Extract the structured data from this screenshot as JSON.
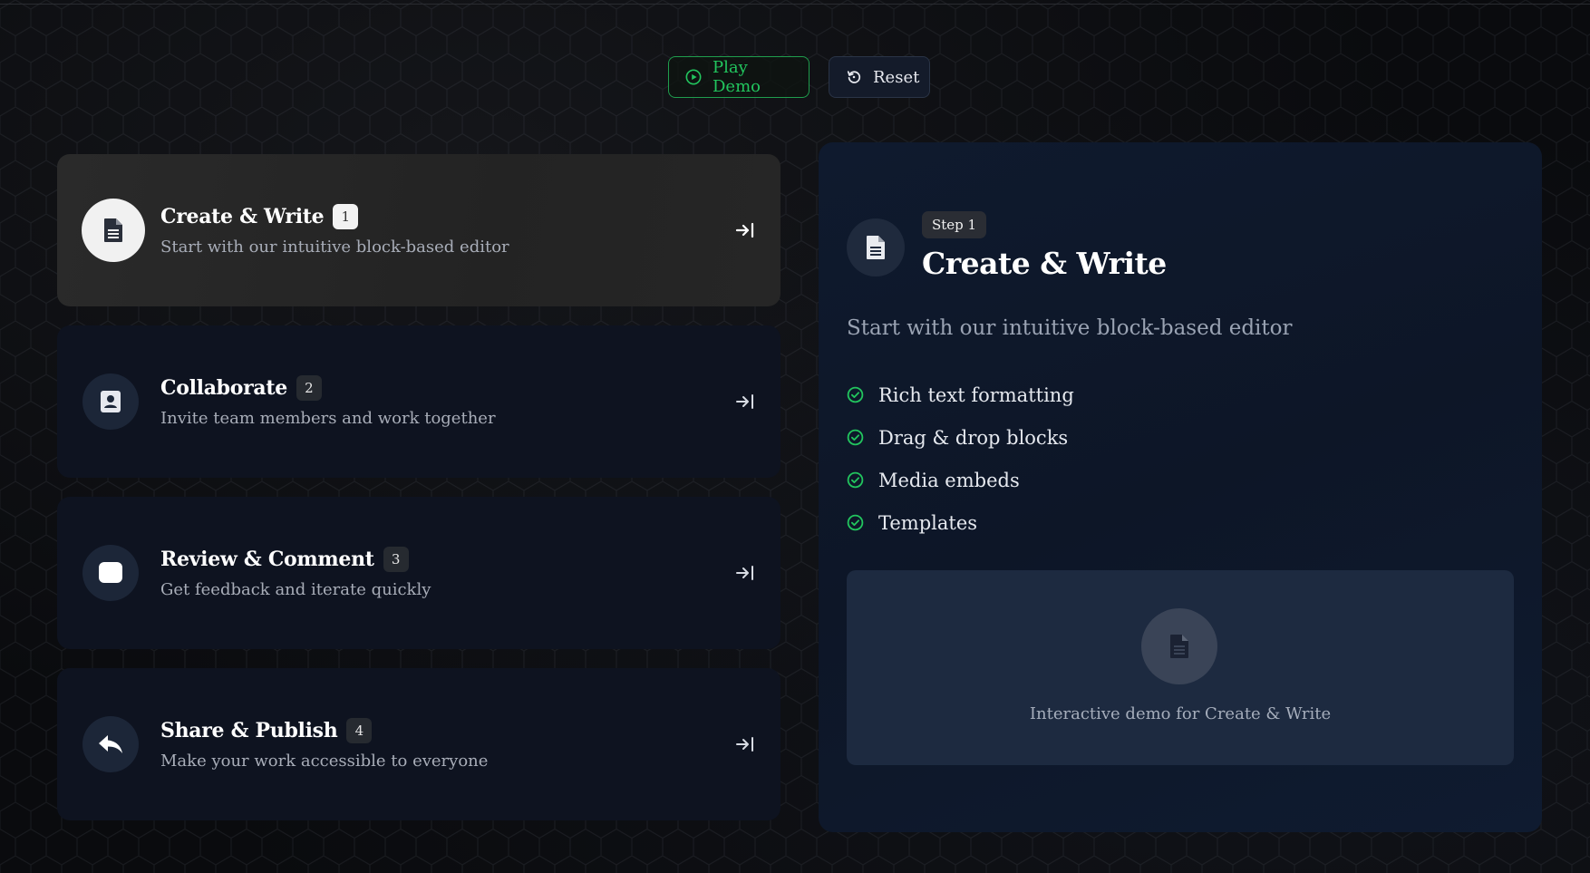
{
  "controls": {
    "play_label": "Play Demo",
    "reset_label": "Reset"
  },
  "steps": [
    {
      "title": "Create & Write",
      "number": "1",
      "description": "Start with our intuitive block-based editor",
      "icon": "document-icon",
      "active": true
    },
    {
      "title": "Collaborate",
      "number": "2",
      "description": "Invite team members and work together",
      "icon": "contact-icon",
      "active": false
    },
    {
      "title": "Review & Comment",
      "number": "3",
      "description": "Get feedback and iterate quickly",
      "icon": "comment-icon",
      "active": false
    },
    {
      "title": "Share & Publish",
      "number": "4",
      "description": "Make your work accessible to everyone",
      "icon": "reply-icon",
      "active": false
    }
  ],
  "detail": {
    "badge": "Step 1",
    "title": "Create & Write",
    "description": "Start with our intuitive block-based editor",
    "features": [
      "Rich text formatting",
      "Drag & drop blocks",
      "Media embeds",
      "Templates"
    ],
    "demo_text": "Interactive demo for Create & Write"
  },
  "colors": {
    "accent_green": "#22c55e",
    "panel_bg": "#0f1a2e",
    "card_bg": "#0e1320",
    "active_card_bg": "#262626"
  }
}
